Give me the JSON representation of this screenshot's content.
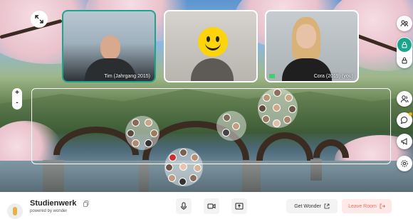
{
  "room": {
    "title": "Studienwerk",
    "powered_by": "powered by wonder"
  },
  "videos": [
    {
      "name": "Tim (Jahrgang 2015)",
      "active": true
    },
    {
      "name": "",
      "active": false
    },
    {
      "name": "Cora (2019) (you)",
      "active": false
    }
  ],
  "zoom": {
    "plus": "+",
    "minus": "-"
  },
  "actions": {
    "get_wonder": "Get Wonder",
    "leave_room": "Leave Room"
  },
  "icons": {
    "expand": "expand-icon",
    "lock": "lock-icon",
    "unlock": "unlock-icon",
    "people": "people-icon",
    "chat": "chat-bubble-icon",
    "broadcast": "megaphone-icon",
    "settings": "gear-icon",
    "mic": "microphone-icon",
    "camera": "camera-icon",
    "share": "screen-share-icon",
    "copy": "copy-icon",
    "external": "external-link-icon",
    "exit": "exit-icon"
  },
  "colors": {
    "accent": "#1aa58c",
    "leave_text": "#ef6f5f",
    "leave_bg": "#fde9e7"
  }
}
